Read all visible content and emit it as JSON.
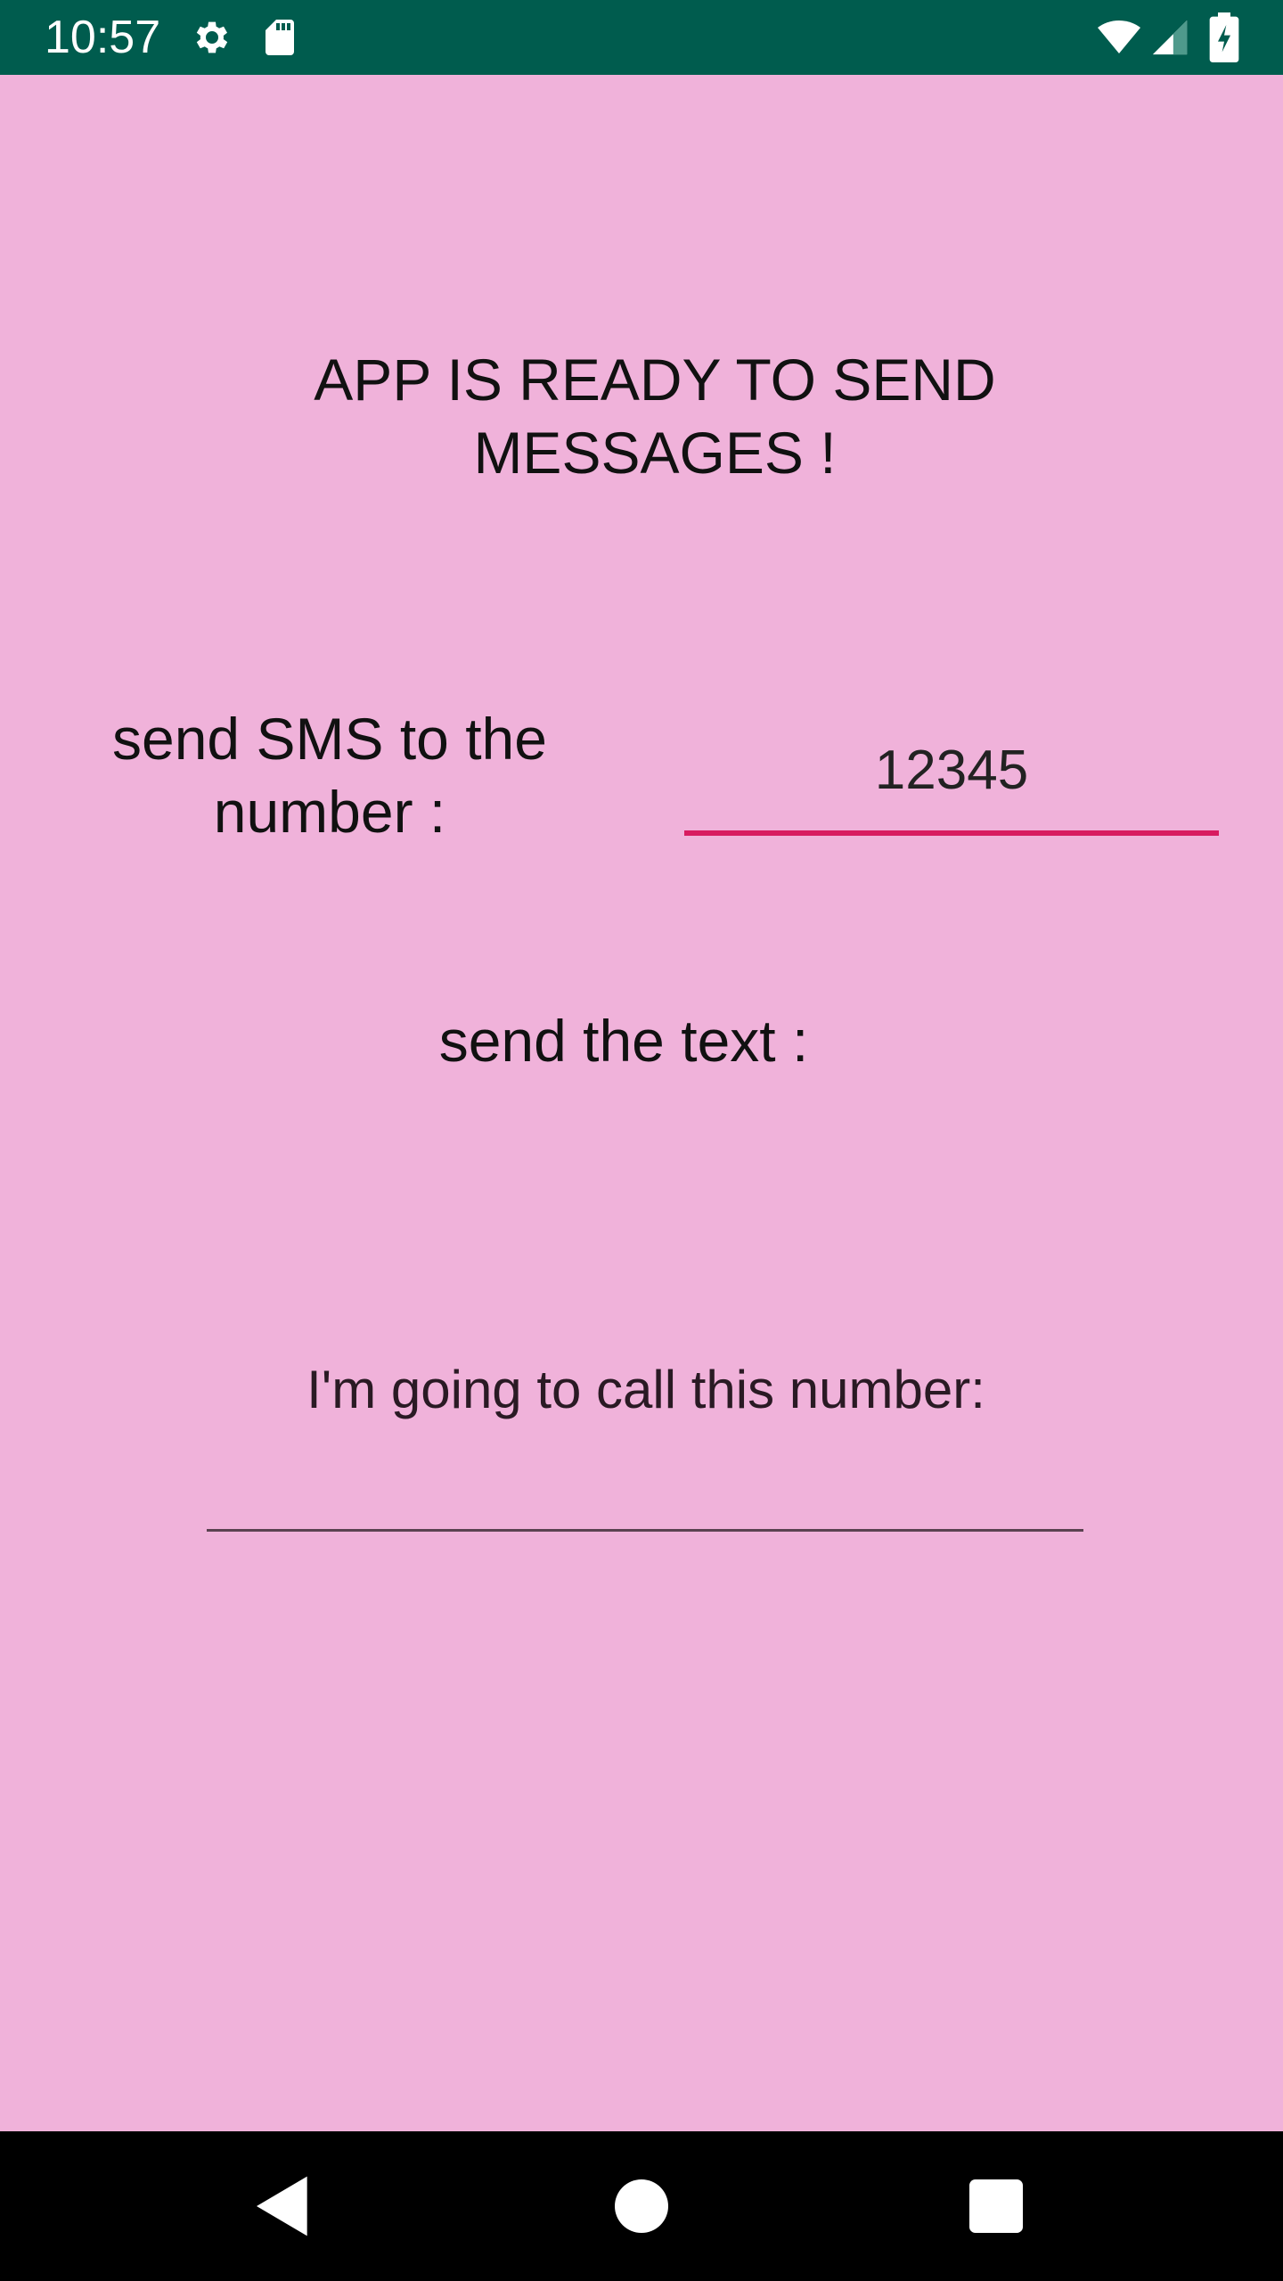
{
  "status_bar": {
    "time": "10:57",
    "background_color": "#005c4e",
    "left_icons": [
      "settings-icon",
      "sd-card-icon"
    ],
    "right_icons": [
      "wifi-icon",
      "cell-signal-icon",
      "battery-charging-icon"
    ]
  },
  "screen": {
    "background_color": "#f0b2da",
    "headline": "APP IS READY TO SEND MESSAGES !",
    "sms_label": "send SMS to the number :",
    "number_input": {
      "value": "12345",
      "underline_color": "#d81b60"
    },
    "text_label": "send the text :",
    "call_label": "I'm going to call this number:",
    "call_input": {
      "value": ""
    }
  },
  "nav_bar": {
    "buttons": [
      "back-icon",
      "home-icon",
      "recents-icon"
    ]
  }
}
